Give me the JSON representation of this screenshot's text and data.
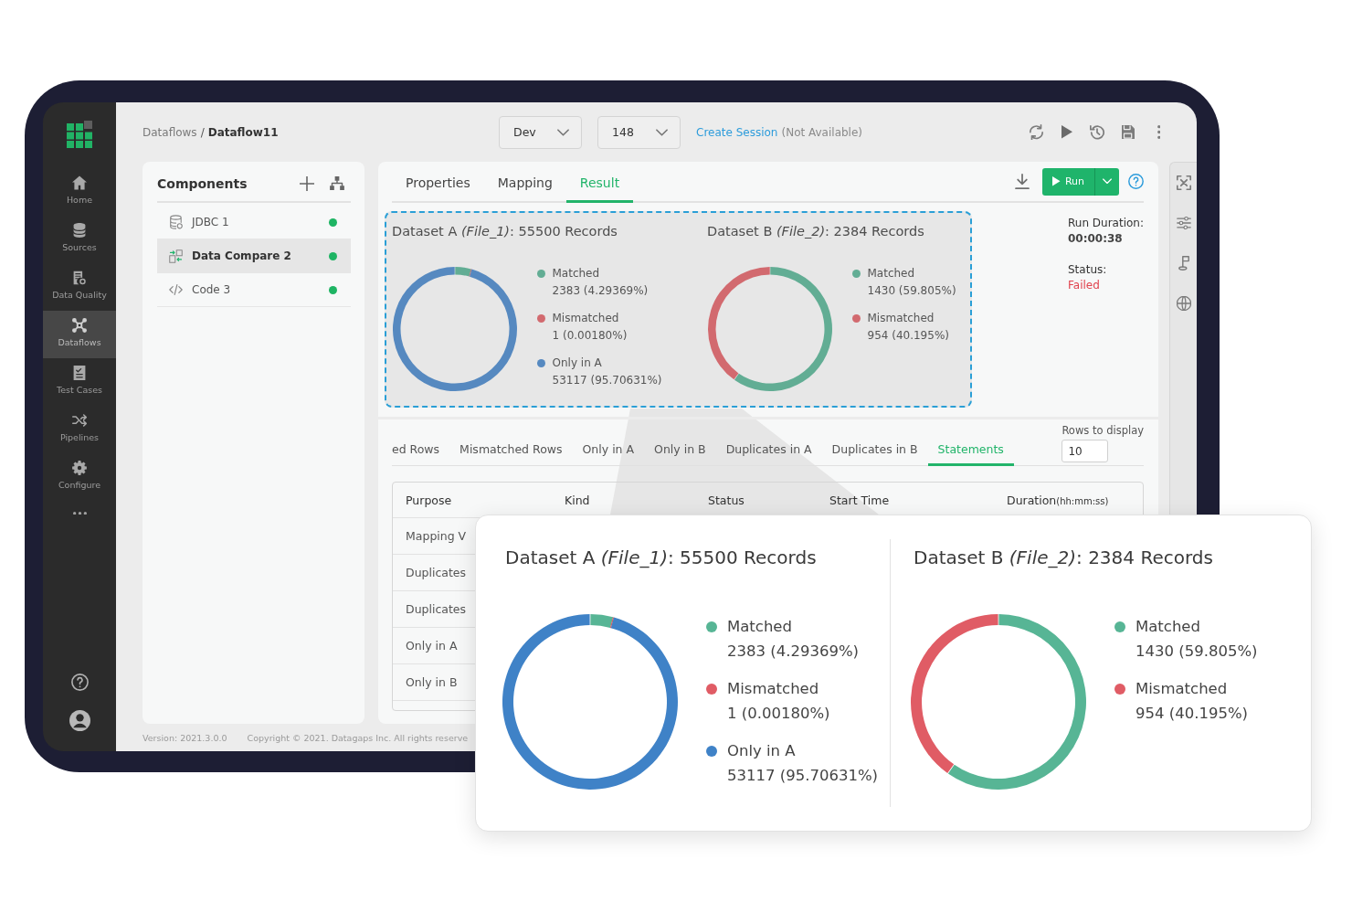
{
  "sidebar": {
    "items": [
      {
        "label": "Home",
        "selected": false
      },
      {
        "label": "Sources",
        "selected": false
      },
      {
        "label": "Data Quality",
        "selected": false
      },
      {
        "label": "Dataflows",
        "selected": true
      },
      {
        "label": "Test Cases",
        "selected": false
      },
      {
        "label": "Pipelines",
        "selected": false
      },
      {
        "label": "Configure",
        "selected": false
      }
    ]
  },
  "breadcrumb": {
    "items": [
      "Dataflows",
      "Dataflow11"
    ],
    "separator": "/"
  },
  "toolbar": {
    "dropdowns": [
      {
        "value": "Dev"
      },
      {
        "value": "148"
      }
    ],
    "link": "Create Session",
    "note": "(Not Available)"
  },
  "components": {
    "title": "Components",
    "items": [
      {
        "label": "JDBC 1",
        "selected": false,
        "color": "#1eb463"
      },
      {
        "label": "Data Compare 2",
        "selected": true,
        "color": "#1eb463"
      },
      {
        "label": "Code 3",
        "selected": false,
        "color": "#1eb463"
      }
    ]
  },
  "tabs": [
    {
      "label": "Properties",
      "selected": false
    },
    {
      "label": "Mapping",
      "selected": false
    },
    {
      "label": "Result",
      "selected": true
    }
  ],
  "run_button": {
    "label": "Run"
  },
  "result": {
    "datasets": [
      {
        "title": "Dataset A *(File_1)*: 55500 Records",
        "chart_data": {
          "type": "donut",
          "categories": [
            "Matched",
            "Mismatched",
            "Only in A"
          ],
          "values": [
            4.29369,
            0.0018,
            95.70631
          ]
        },
        "legend": [
          {
            "value": "2383 (4.29369%)",
            "color": "#62ad94"
          },
          {
            "value": "1 (0.00180%)",
            "color": "#d26a6f"
          },
          {
            "value": "53117 (95.70631%)",
            "color": "#5689c0"
          }
        ]
      },
      {
        "title": "Dataset B *(File_2)*: 2384 Records",
        "chart_data": {
          "type": "donut",
          "categories": [
            "Matched",
            "Mismatched"
          ],
          "values": [
            59.805,
            40.195
          ]
        },
        "legend": [
          {
            "value": "1430 (59.805%)",
            "color": "#62ad94"
          },
          {
            "value": "954 (40.195%)",
            "color": "#d26a6f"
          }
        ]
      }
    ],
    "run_duration": {
      "label": "Run Duration:",
      "value": "00:00:38"
    },
    "status": {
      "label": "Status:",
      "value": "Failed"
    }
  },
  "result_tabs": {
    "items": [
      {
        "label": "ed Rows",
        "selected": false
      },
      {
        "label": "Mismatched Rows",
        "selected": false
      },
      {
        "label": "Only in A",
        "selected": false
      },
      {
        "label": "Only in B",
        "selected": false
      },
      {
        "label": "Duplicates in A",
        "selected": false
      },
      {
        "label": "Duplicates in B",
        "selected": false
      },
      {
        "label": "Statements",
        "selected": true
      }
    ],
    "rows_to_display": {
      "label": "Rows to display",
      "value": "10"
    }
  },
  "table": {
    "columns": [
      {
        "label": "Purpose"
      },
      {
        "label": "Kind"
      },
      {
        "label": "Status"
      },
      {
        "label": "Start Time"
      },
      {
        "label": "Duration",
        "unit": "(hh:mm:ss)"
      }
    ],
    "rows": [
      {
        "purpose": "Mapping V"
      },
      {
        "purpose": "Duplicates"
      },
      {
        "purpose": "Duplicates"
      },
      {
        "purpose": "Only in A"
      },
      {
        "purpose": "Only in B"
      }
    ]
  },
  "footer": {
    "version": "Version: 2021.3.0.0",
    "copyright": "Copyright © 2021. Datagaps Inc. All rights reserve"
  },
  "zoom_card": {
    "datasets": [
      {
        "title": "Dataset A *(File_1)*: 55500 Records",
        "chart_data": {
          "type": "donut",
          "categories": [
            "Matched",
            "Mismatched",
            "Only in A"
          ],
          "values": [
            4.29369,
            0.0018,
            95.70631
          ]
        },
        "legend": [
          {
            "value": "2383 (4.29369%)",
            "color": "#57b595"
          },
          {
            "value": "1 (0.00180%)",
            "color": "#e05c65"
          },
          {
            "value": "53117 (95.70631%)",
            "color": "#3f82c7"
          }
        ]
      },
      {
        "title": "Dataset B *(File_2)*: 2384 Records",
        "chart_data": {
          "type": "donut",
          "categories": [
            "Matched",
            "Mismatched"
          ],
          "values": [
            59.805,
            40.195
          ]
        },
        "legend": [
          {
            "value": "1430 (59.805%)",
            "color": "#57b595"
          },
          {
            "value": "954 (40.195%)",
            "color": "#e05c65"
          }
        ]
      }
    ]
  }
}
